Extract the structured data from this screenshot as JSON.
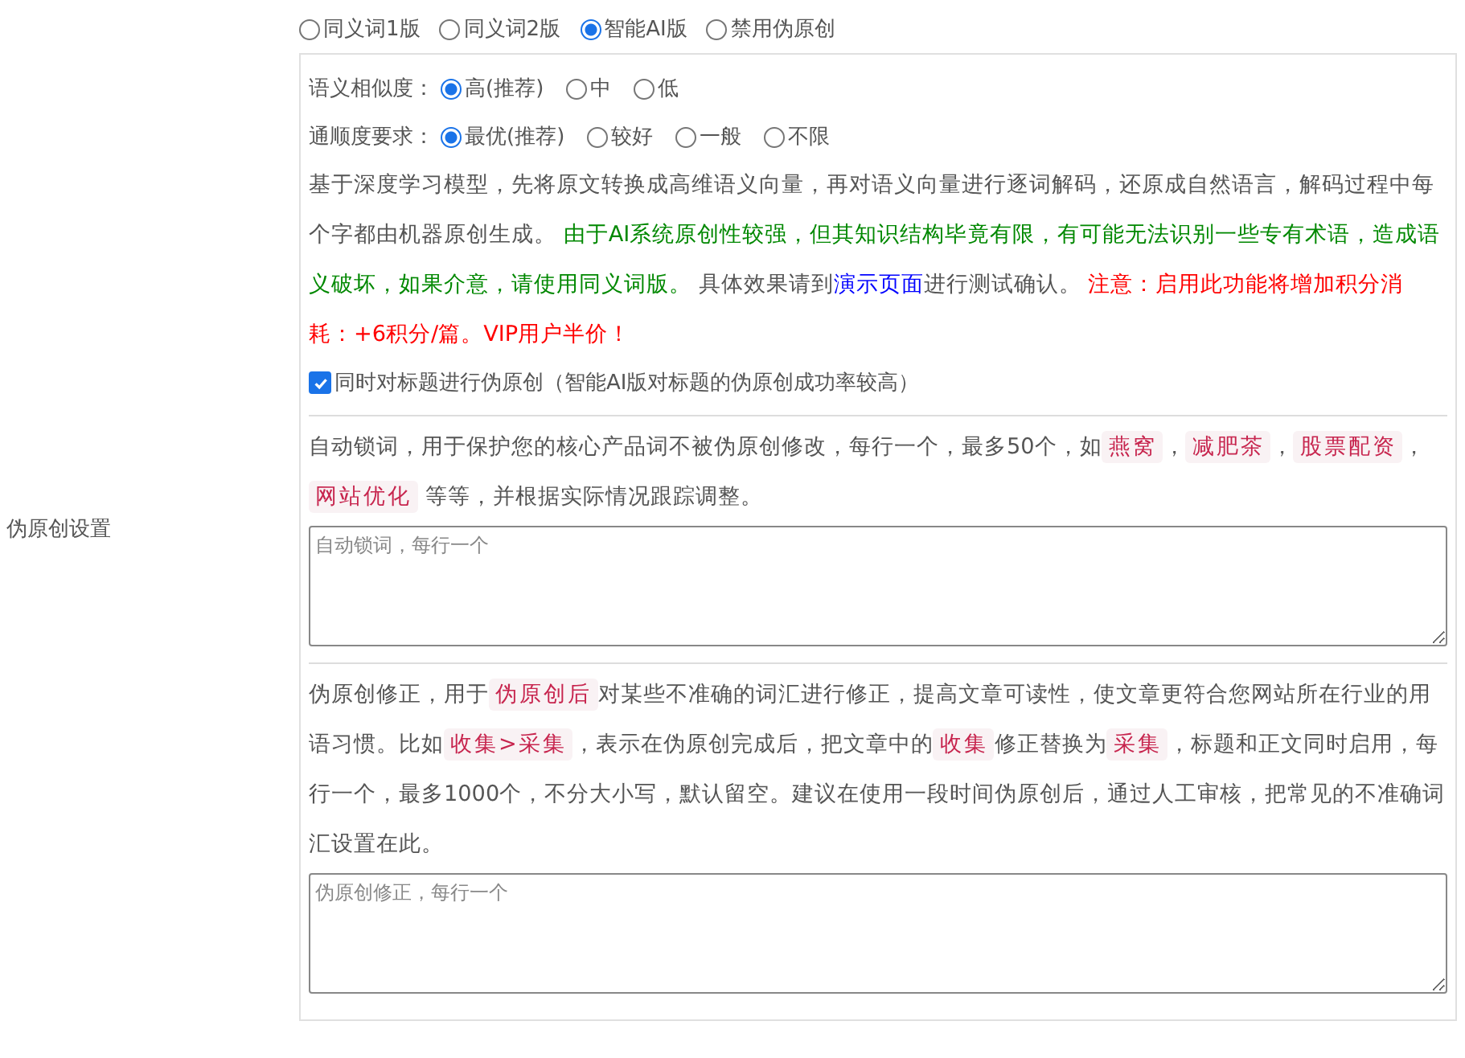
{
  "section_label": "伪原创设置",
  "modes": [
    {
      "label": "同义词1版",
      "selected": false
    },
    {
      "label": "同义词2版",
      "selected": false
    },
    {
      "label": "智能AI版",
      "selected": true
    },
    {
      "label": "禁用伪原创",
      "selected": false
    }
  ],
  "similarity": {
    "label": "语义相似度：",
    "options": [
      {
        "label": "高(推荐)",
        "selected": true
      },
      {
        "label": "中",
        "selected": false
      },
      {
        "label": "低",
        "selected": false
      }
    ]
  },
  "fluency": {
    "label": "通顺度要求：",
    "options": [
      {
        "label": "最优(推荐)",
        "selected": true
      },
      {
        "label": "较好",
        "selected": false
      },
      {
        "label": "一般",
        "selected": false
      },
      {
        "label": "不限",
        "selected": false
      }
    ]
  },
  "description": [
    {
      "kind": "plain",
      "text": "基于深度学习模型，先将原文转换成高维语义向量，再对语义向量进行逐词解码，还原成自然语言，解码过程中每个字都由机器原创生成。 "
    },
    {
      "kind": "notice",
      "text": "由于AI系统原创性较强，但其知识结构毕竟有限，有可能无法识别一些专有术语，造成语义破坏，如果介意，请使用同义词版。"
    },
    {
      "kind": "plain",
      "text": " 具体效果请到"
    },
    {
      "kind": "link",
      "text": "演示页面"
    },
    {
      "kind": "plain",
      "text": "进行测试确认。 "
    },
    {
      "kind": "warning",
      "text": "注意：启用此功能将增加积分消耗：+6积分/篇。VIP用户半价！"
    }
  ],
  "title_option": {
    "label": "同时对标题进行伪原创（智能AI版对标题的伪原创成功率较高）",
    "checked": true
  },
  "lock_words": {
    "description": [
      {
        "kind": "plain",
        "text": "自动锁词，用于保护您的核心产品词不被伪原创修改，每行一个，最多50个，如"
      },
      {
        "kind": "code",
        "text": "燕窝"
      },
      {
        "kind": "plain",
        "text": "，"
      },
      {
        "kind": "code",
        "text": "减肥茶"
      },
      {
        "kind": "plain",
        "text": "，"
      },
      {
        "kind": "code",
        "text": "股票配资"
      },
      {
        "kind": "plain",
        "text": "，"
      },
      {
        "kind": "code",
        "text": "网站优化"
      },
      {
        "kind": "plain",
        "text": " 等等，并根据实际情况跟踪调整。"
      }
    ],
    "placeholder": "自动锁词，每行一个"
  },
  "corrections": {
    "description": [
      {
        "kind": "plain",
        "text": "伪原创修正，用于"
      },
      {
        "kind": "code",
        "text": "伪原创后"
      },
      {
        "kind": "plain",
        "text": "对某些不准确的词汇进行修正，提高文章可读性，使文章更符合您网站所在行业的用语习惯。比如"
      },
      {
        "kind": "code",
        "text": "收集>采集"
      },
      {
        "kind": "plain",
        "text": "，表示在伪原创完成后，把文章中的"
      },
      {
        "kind": "code",
        "text": "收集"
      },
      {
        "kind": "plain",
        "text": "修正替换为"
      },
      {
        "kind": "code",
        "text": "采集"
      },
      {
        "kind": "plain",
        "text": "，标题和正文同时启用，每行一个，最多1000个，不分大小写，默认留空。建议在使用一段时间伪原创后，通过人工审核，把常见的不准确词汇设置在此。"
      }
    ],
    "placeholder": "伪原创修正，每行一个"
  }
}
